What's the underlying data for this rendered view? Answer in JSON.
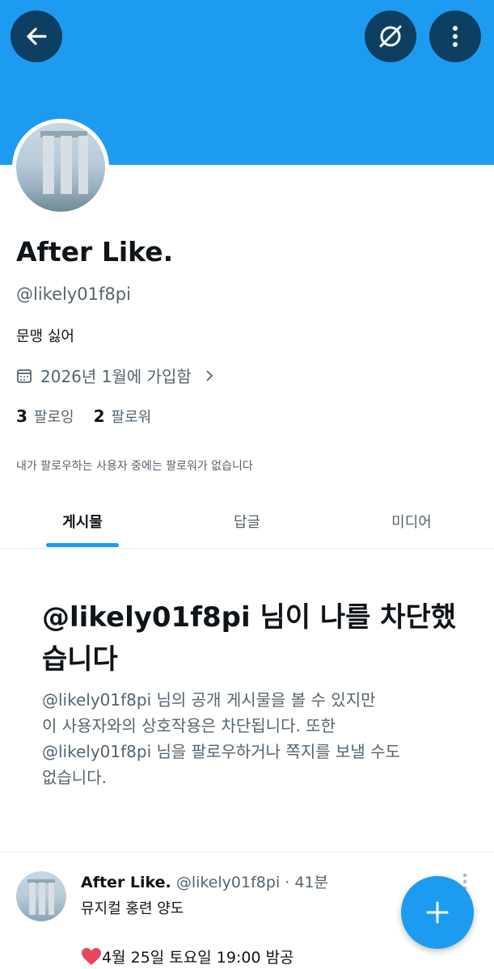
{
  "colors": {
    "accent": "#1d9bf0",
    "header_button": "#0d3f63",
    "secondary_text": "#536471"
  },
  "profile": {
    "name": "After Like.",
    "handle": "@likely01f8pi",
    "bio": "문맹 싫어",
    "joined": "2026년 1월에 가입함",
    "following_count": "3",
    "following_label": "팔로잉",
    "followers_count": "2",
    "followers_label": "팔로워",
    "no_followers_you_know": "내가 팔로우하는 사용자 중에는 팔로워가 없습니다"
  },
  "header": {
    "back_icon": "arrow-left-icon",
    "icon2": "unmute-eye-slash-icon",
    "more_icon": "more-vertical-icon"
  },
  "tabs": [
    {
      "label": "게시물",
      "active": true
    },
    {
      "label": "답글",
      "active": false
    },
    {
      "label": "미디어",
      "active": false
    }
  ],
  "blocked": {
    "title": "@likely01f8pi 님이 나를 차단했습니다",
    "body_line1": "@likely01f8pi 님의 공개 게시물을 볼 수 있지만",
    "body_line2": "이 사용자와의 상호작용은 차단됩니다. 또한",
    "body_line3": "@likely01f8pi 님을 팔로우하거나 쪽지를 보낼 수도",
    "body_line4": "없습니다."
  },
  "post": {
    "name": "After Like.",
    "handle": "@likely01f8pi",
    "time": "· 41분",
    "line1": "뮤지컬 홍련 양도",
    "line2": "4월 25일 토요일 19:00 밤공",
    "line2_icon": "heart-icon"
  },
  "fab": {
    "icon": "plus-icon"
  }
}
